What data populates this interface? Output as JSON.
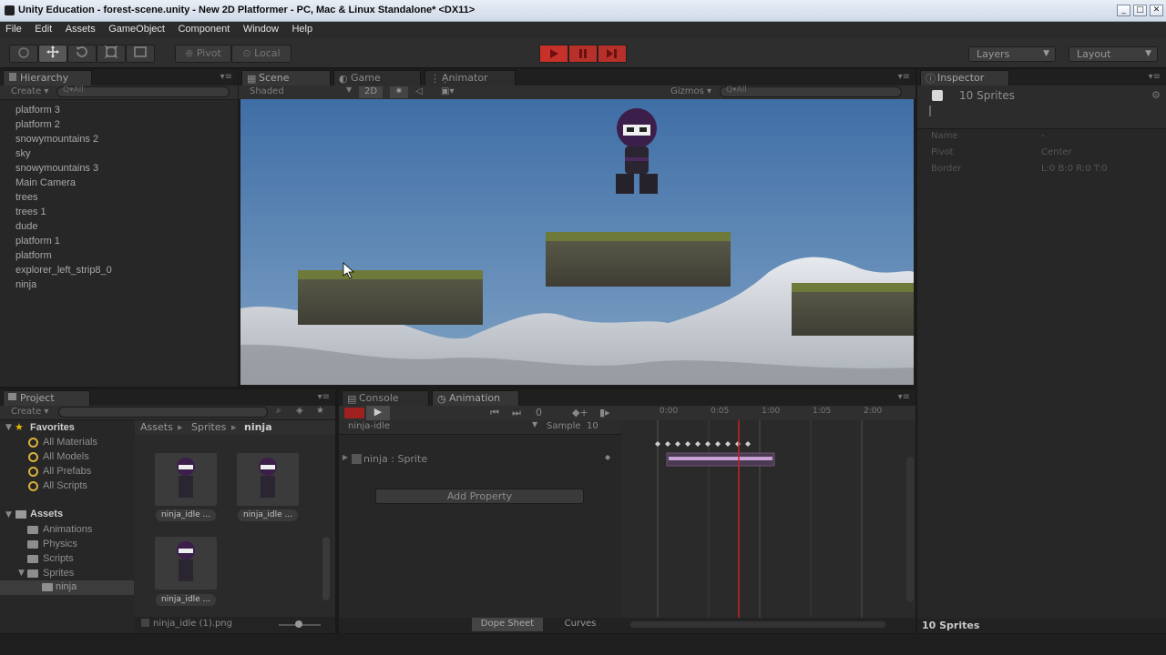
{
  "window": {
    "title": "Unity Education - forest-scene.unity - New 2D Platformer - PC, Mac & Linux Standalone* <DX11>",
    "buttons": [
      "_",
      "□",
      "✕"
    ]
  },
  "menu": [
    "File",
    "Edit",
    "Assets",
    "GameObject",
    "Component",
    "Window",
    "Help"
  ],
  "toolbar": {
    "pivot_label": "Pivot",
    "local_label": "Local",
    "layers_label": "Layers",
    "layout_label": "Layout"
  },
  "hierarchy": {
    "tab_label": "Hierarchy",
    "create_label": "Create ▾",
    "search_placeholder": "Q▾All",
    "items": [
      "platform 3",
      "platform 2",
      "snowymountains 2",
      "sky",
      "snowymountains 3",
      "Main Camera",
      "trees",
      "trees 1",
      "dude",
      "platform 1",
      "platform",
      "explorer_left_strip8_0",
      "ninja"
    ]
  },
  "scene": {
    "tabs": [
      "Scene",
      "Game",
      "Animator"
    ],
    "shaded_label": "Shaded",
    "mode_2d": "2D",
    "gizmos_label": "Gizmos ▾",
    "search_placeholder": "Q▾All"
  },
  "inspector": {
    "tab_label": "Inspector",
    "title": "10 Sprites",
    "fields": [
      {
        "label": "Name",
        "value": "-"
      },
      {
        "label": "Pivot",
        "value": "Center"
      },
      {
        "label": "Border",
        "value": "L:0 B:0 R:0 T:0"
      }
    ],
    "footer": "10 Sprites"
  },
  "project": {
    "tab_label": "Project",
    "create_label": "Create ▾",
    "favorites_label": "Favorites",
    "favorites": [
      "All Materials",
      "All Models",
      "All Prefabs",
      "All Scripts"
    ],
    "assets_label": "Assets",
    "folders": [
      "Animations",
      "Physics",
      "Scripts",
      "Sprites",
      "ninja"
    ],
    "breadcrumb": [
      "Assets",
      "Sprites",
      "ninja"
    ],
    "thumbs": [
      "ninja_idle ...",
      "ninja_idle ...",
      "ninja_idle ..."
    ],
    "status_file": "ninja_idle (1).png"
  },
  "animation": {
    "tabs": [
      "Console",
      "Animation"
    ],
    "clip_name": "ninja-idle",
    "sample_label": "Sample",
    "sample_value": "10",
    "property_label": "ninja : Sprite",
    "add_property_label": "Add Property",
    "timeline_ticks": [
      "0:00",
      "0:05",
      "1:00",
      "1:05",
      "2:00"
    ],
    "footer_tabs": [
      "Dope Sheet",
      "Curves"
    ]
  },
  "colors": {
    "sky": "#4e7bb0",
    "play_red": "#c8312a",
    "favorite_star": "#e8b800",
    "playhead": "#d02020"
  }
}
